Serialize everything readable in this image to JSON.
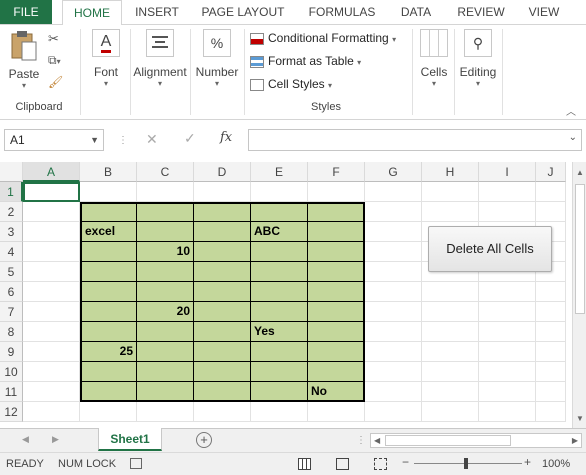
{
  "ribbon_tabs": [
    "FILE",
    "HOME",
    "INSERT",
    "PAGE LAYOUT",
    "FORMULAS",
    "DATA",
    "REVIEW",
    "VIEW"
  ],
  "ribbon": {
    "paste": "Paste",
    "clipboard": "Clipboard",
    "font": "Font",
    "alignment": "Alignment",
    "number": "Number",
    "conditional_formatting": "Conditional Formatting",
    "format_as_table": "Format as Table",
    "cell_styles": "Cell Styles",
    "styles": "Styles",
    "cells": "Cells",
    "editing": "Editing"
  },
  "formula_bar": {
    "name_box": "A1",
    "fx": "fx",
    "value": ""
  },
  "columns": [
    "A",
    "B",
    "C",
    "D",
    "E",
    "F",
    "G",
    "H",
    "I",
    "J"
  ],
  "rows": [
    "1",
    "2",
    "3",
    "4",
    "5",
    "6",
    "7",
    "8",
    "9",
    "10",
    "11",
    "12"
  ],
  "cells": {
    "B3": "excel",
    "E3": "ABC",
    "C4": "10",
    "C7": "20",
    "E8": "Yes",
    "B9": "25",
    "F11": "No"
  },
  "button": {
    "label": "Delete All Cells"
  },
  "sheet_tab": "Sheet1",
  "status": {
    "ready": "READY",
    "num_lock": "NUM LOCK",
    "zoom": "100%"
  },
  "colors": {
    "accent": "#217346",
    "cell_fill": "#c4d79b"
  }
}
